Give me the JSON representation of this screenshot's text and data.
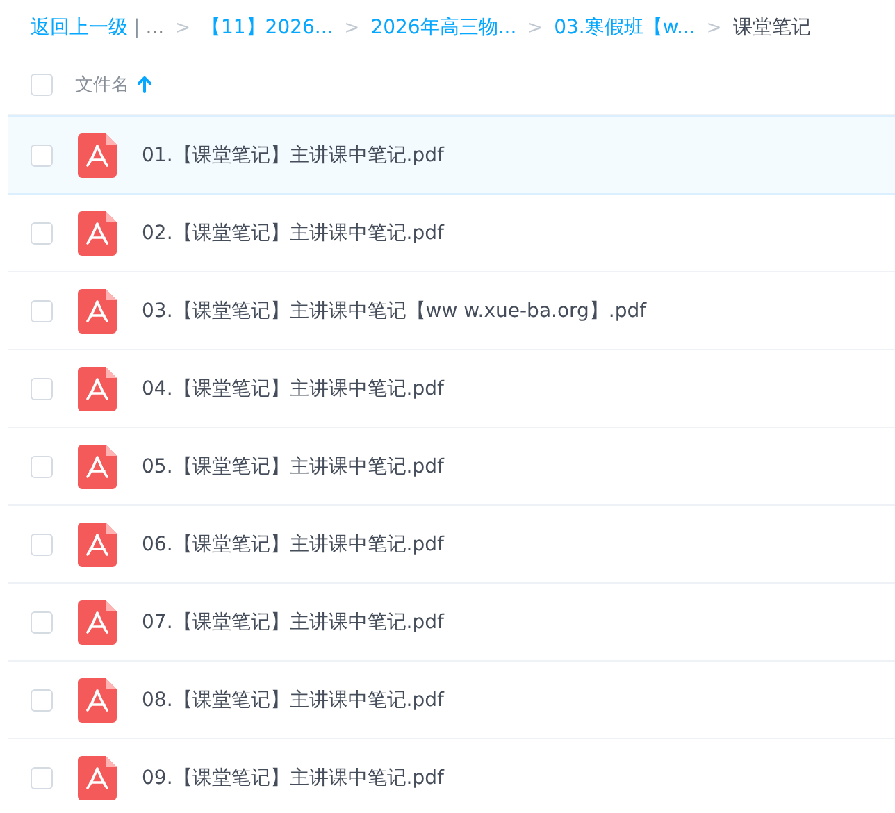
{
  "breadcrumb": {
    "back": "返回上一级",
    "divider": "|",
    "items": [
      {
        "kind": "ellipsis",
        "label": "..."
      },
      {
        "kind": "link",
        "label": "【11】2026...",
        "separator": ">"
      },
      {
        "kind": "link",
        "label": "2026年高三物...",
        "separator": ">"
      },
      {
        "kind": "link",
        "label": "03.寒假班【w...",
        "separator": ">"
      },
      {
        "kind": "current",
        "label": "课堂笔记",
        "separator": ">"
      }
    ]
  },
  "header": {
    "checked": false,
    "column": "文件名",
    "sort_ascending": true
  },
  "files": [
    {
      "name": "01.【课堂笔记】主讲课中笔记.pdf",
      "checked": false,
      "selected": true
    },
    {
      "name": "02.【课堂笔记】主讲课中笔记.pdf",
      "checked": false,
      "selected": false
    },
    {
      "name": "03.【课堂笔记】主讲课中笔记【ww w.xue-ba.org】.pdf",
      "checked": false,
      "selected": false
    },
    {
      "name": "04.【课堂笔记】主讲课中笔记.pdf",
      "checked": false,
      "selected": false
    },
    {
      "name": "05.【课堂笔记】主讲课中笔记.pdf",
      "checked": false,
      "selected": false
    },
    {
      "name": "06.【课堂笔记】主讲课中笔记.pdf",
      "checked": false,
      "selected": false
    },
    {
      "name": "07.【课堂笔记】主讲课中笔记.pdf",
      "checked": false,
      "selected": false
    },
    {
      "name": "08.【课堂笔记】主讲课中笔记.pdf",
      "checked": false,
      "selected": false
    },
    {
      "name": "09.【课堂笔记】主讲课中笔记.pdf",
      "checked": false,
      "selected": false
    }
  ]
}
